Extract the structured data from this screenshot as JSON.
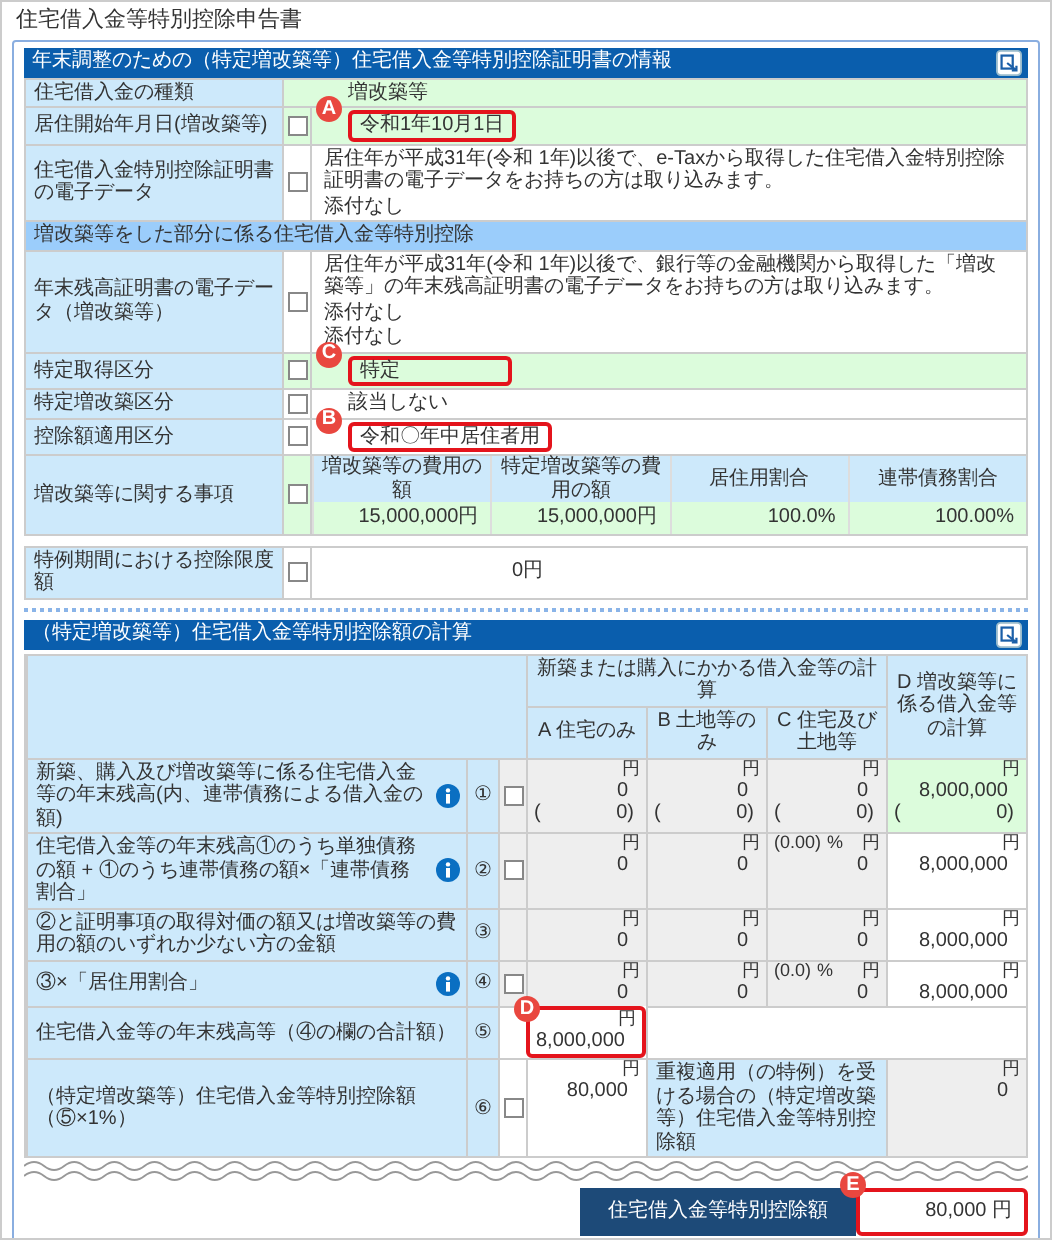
{
  "page_title": "住宅借入金等特別控除申告書",
  "certificate": {
    "title": "年末調整のための（特定増改築等）住宅借入金等特別控除証明書の情報",
    "rows": [
      {
        "kind": "value",
        "label": "住宅借入金の種類",
        "value": "増改築等",
        "auto": true
      },
      {
        "kind": "value",
        "label": "居住開始年月日(増改築等)",
        "checked": false,
        "value": "令和1年10月1日",
        "auto": true,
        "callout": "A"
      },
      {
        "kind": "note",
        "label": "住宅借入金特別控除証明書の電子データ",
        "checked": false,
        "lines": [
          "居住年が平成31年(令和 1年)以後で、e-Taxから取得した住宅借入金特別控除証明書の電子データをお持ちの方は取り込みます。",
          "添付なし"
        ]
      }
    ],
    "subtitle": "増改築等をした部分に係る住宅借入金等特別控除",
    "sub_rows": [
      {
        "kind": "note",
        "label": "年末残高証明書の電子データ（増改築等）",
        "checked": false,
        "lines": [
          "居住年が平成31年(令和 1年)以後で、銀行等の金融機関から取得した「増改築等」の年末残高証明書の電子データをお持ちの方は取り込みます。",
          "添付なし",
          "添付なし"
        ]
      },
      {
        "kind": "value",
        "label": "特定取得区分",
        "checked": false,
        "value": "特定",
        "auto": true,
        "callout": "C"
      },
      {
        "kind": "value",
        "label": "特定増改築区分",
        "checked": false,
        "value": "該当しない",
        "auto": false
      },
      {
        "kind": "value",
        "label": "控除額適用区分",
        "checked": false,
        "value": "令和〇年中居住者用",
        "auto": false,
        "callout": "B"
      },
      {
        "kind": "amounts",
        "label": "増改築等に関する事項",
        "checked": false,
        "auto": true,
        "columns": [
          {
            "heading": "増改築等の費用の額",
            "value": "15,000,000円"
          },
          {
            "heading": "特定増改築等の費用の額",
            "value": "15,000,000円"
          },
          {
            "heading": "居住用割合",
            "value": "100.0%"
          },
          {
            "heading": "連帯債務割合",
            "value": "100.00%"
          }
        ]
      }
    ],
    "limit": {
      "label": "特例期間における控除限度額",
      "checked": false,
      "value": "0円"
    }
  },
  "calculation": {
    "title": "（特定増改築等）住宅借入金等特別控除額の計算",
    "group_heading": "新築または購入にかかる借入金等の計算",
    "columns": [
      "A 住宅のみ",
      "B 土地等のみ",
      "C 住宅及び土地等",
      "D 増改築等に係る借入金等の計算"
    ],
    "rows": [
      {
        "kind": "cells",
        "label": "新築、購入及び増改築等に係る住宅借入金等の年末残高(内、連帯債務による借入金の額)",
        "info": true,
        "number": "①",
        "checked": false,
        "cells": [
          {
            "unit": "円",
            "value": "0",
            "sub_open": "(",
            "sub": "0)",
            "disabled": true,
            "auto": false
          },
          {
            "unit": "円",
            "value": "0",
            "sub_open": "(",
            "sub": "0)",
            "disabled": true,
            "auto": false
          },
          {
            "unit": "円",
            "value": "0",
            "sub_open": "(",
            "sub": "0)",
            "disabled": true,
            "auto": false
          },
          {
            "unit": "円",
            "value": "8,000,000",
            "sub_open": "(",
            "sub": "0)",
            "disabled": false,
            "auto": true
          }
        ]
      },
      {
        "kind": "cells",
        "label": "住宅借入金等の年末残高①のうち単独債務の額 + ①のうち連帯債務の額×「連帯債務割合」",
        "info": true,
        "number": "②",
        "checked": false,
        "cells": [
          {
            "unit": "円",
            "value": "0",
            "disabled": true,
            "auto": false
          },
          {
            "unit": "円",
            "value": "0",
            "disabled": true,
            "auto": false
          },
          {
            "rate": "(0.00)",
            "rate_unit": "%",
            "unit": "円",
            "value": "0",
            "disabled": true,
            "auto": false
          },
          {
            "unit": "円",
            "value": "8,000,000",
            "disabled": false,
            "auto": false
          }
        ]
      },
      {
        "kind": "cells",
        "label": "②と証明事項の取得対価の額又は増改築等の費用の額のいずれか少ない方の金額",
        "info": false,
        "number": "③",
        "cells": [
          {
            "unit": "円",
            "value": "0",
            "disabled": true,
            "auto": false
          },
          {
            "unit": "円",
            "value": "0",
            "disabled": true,
            "auto": false
          },
          {
            "unit": "円",
            "value": "0",
            "disabled": true,
            "auto": false
          },
          {
            "unit": "円",
            "value": "8,000,000",
            "disabled": false,
            "auto": false
          }
        ]
      },
      {
        "kind": "cells",
        "label": "③×「居住用割合」",
        "info": true,
        "number": "④",
        "checked": false,
        "cells": [
          {
            "unit": "円",
            "value": "0",
            "disabled": true,
            "auto": false
          },
          {
            "unit": "円",
            "value": "0",
            "disabled": true,
            "auto": false
          },
          {
            "rate": "(0.0)",
            "rate_unit": "%",
            "unit": "円",
            "value": "0",
            "disabled": true,
            "auto": false
          },
          {
            "unit": "円",
            "value": "8,000,000",
            "disabled": false,
            "auto": false
          }
        ]
      },
      {
        "kind": "total",
        "label": "住宅借入金等の年末残高等（④の欄の合計額）",
        "number": "⑤",
        "unit": "円",
        "value": "8,000,000",
        "callout": "D"
      },
      {
        "kind": "deduction",
        "label": "（特定増改築等）住宅借入金等特別控除額（⑤×1%）",
        "number": "⑥",
        "checked": false,
        "unit": "円",
        "value": "80,000",
        "side_label": "重複適用（の特例）を受ける場合の（特定増改築等）住宅借入金等特別控除額",
        "side_unit": "円",
        "side_value": "0"
      }
    ]
  },
  "total": {
    "label": "住宅借入金等特別控除額",
    "value": "80,000 円",
    "callout": "E"
  }
}
